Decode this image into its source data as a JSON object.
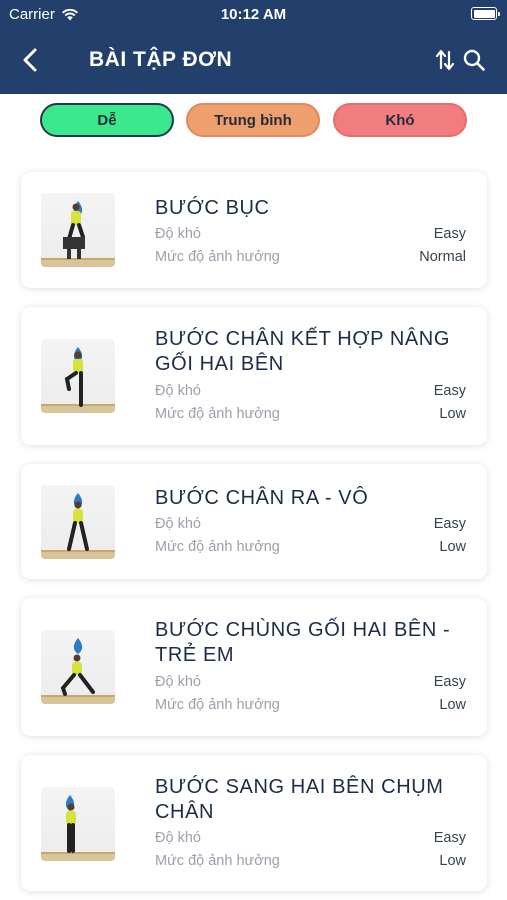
{
  "status_bar": {
    "carrier": "Carrier",
    "time": "10:12 AM"
  },
  "nav": {
    "title": "BÀI TẬP ĐƠN"
  },
  "filters": [
    {
      "label": "Dễ",
      "color": "#3ce88e",
      "selected": true
    },
    {
      "label": "Trung bình",
      "color": "#ef9f6d",
      "selected": false
    },
    {
      "label": "Khó",
      "color": "#f27d7e",
      "selected": false
    }
  ],
  "labels": {
    "difficulty": "Độ khó",
    "impact": "Mức độ ảnh hưởng"
  },
  "exercises": [
    {
      "title": "BƯỚC BỤC",
      "difficulty": "Easy",
      "impact": "Normal"
    },
    {
      "title": "BƯỚC CHÂN KẾT HỢP NÂNG GỐI HAI BÊN",
      "difficulty": "Easy",
      "impact": "Low"
    },
    {
      "title": "BƯỚC CHÂN RA - VÔ",
      "difficulty": "Easy",
      "impact": "Low"
    },
    {
      "title": "BƯỚC CHÙNG GỐI HAI BÊN - TRẺ EM",
      "difficulty": "Easy",
      "impact": "Low"
    },
    {
      "title": "BƯỚC SANG HAI BÊN CHỤM CHÂN",
      "difficulty": "Easy",
      "impact": "Low"
    }
  ],
  "colors": {
    "header": "#22406b",
    "title_text": "#1c2d45"
  }
}
